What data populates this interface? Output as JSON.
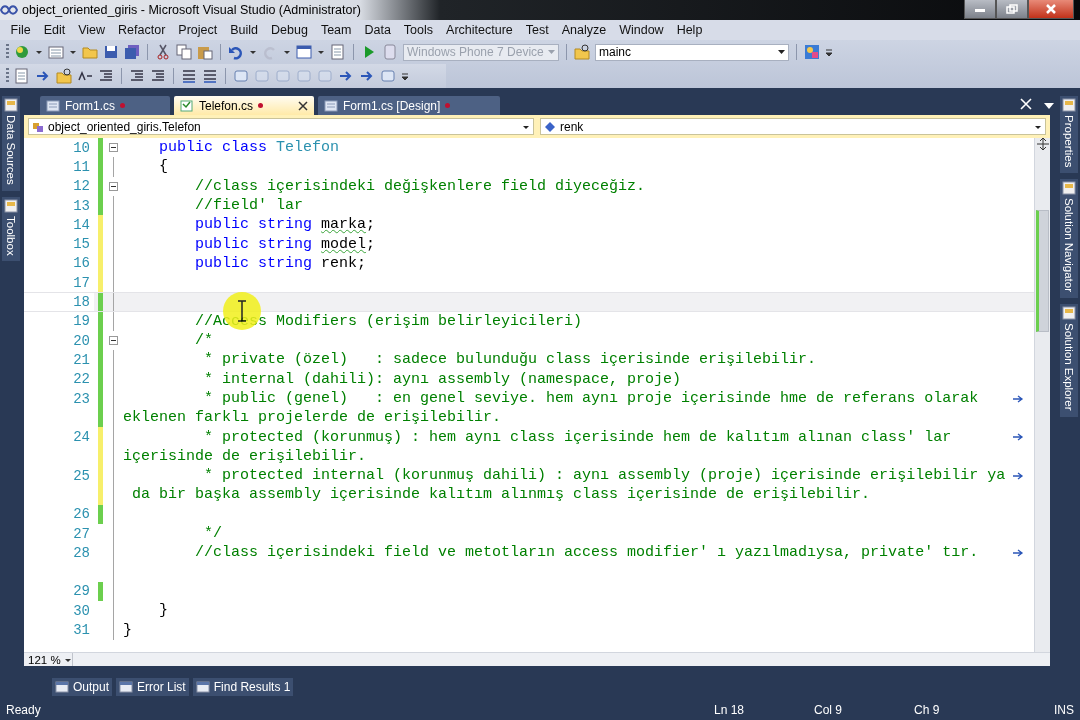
{
  "window": {
    "title": "object_oriented_giris - Microsoft Visual Studio (Administrator)"
  },
  "menu": [
    "File",
    "Edit",
    "View",
    "Refactor",
    "Project",
    "Build",
    "Debug",
    "Team",
    "Data",
    "Tools",
    "Architecture",
    "Test",
    "Analyze",
    "Window",
    "Help"
  ],
  "toolbar": {
    "platform": {
      "value": "Windows Phone 7 Device",
      "disabled": true
    },
    "find": {
      "value": "mainc"
    }
  },
  "left_dock": [
    "Data Sources",
    "Toolbox"
  ],
  "right_dock": [
    "Properties",
    "Solution Navigator",
    "Solution Explorer"
  ],
  "document_tabs": [
    {
      "label": "Form1.cs",
      "selected": false,
      "modified": true
    },
    {
      "label": "Telefon.cs",
      "selected": true,
      "modified": true
    },
    {
      "label": "Form1.cs [Design]",
      "selected": false,
      "modified": true
    }
  ],
  "navigation": {
    "type": "object_oriented_giris.Telefon",
    "member": "renk"
  },
  "editor": {
    "lines": [
      {
        "number": "10",
        "color": "#6ccf4e",
        "foldable": true,
        "current": false,
        "wrapped": false,
        "spans": [
          {
            "kind": "keyword",
            "text": "    public class "
          },
          {
            "kind": "type",
            "text": "Telefon"
          }
        ]
      },
      {
        "number": "11",
        "color": "#6ccf4e",
        "foldable": false,
        "current": false,
        "wrapped": false,
        "spans": [
          {
            "kind": "plain",
            "text": "    {"
          }
        ]
      },
      {
        "number": "12",
        "color": "#6ccf4e",
        "foldable": true,
        "current": false,
        "wrapped": false,
        "spans": [
          {
            "kind": "comment",
            "text": "        //class içerisindeki değişkenlere field diyeceğiz."
          }
        ]
      },
      {
        "number": "13",
        "color": "#6ccf4e",
        "foldable": false,
        "current": false,
        "wrapped": false,
        "spans": [
          {
            "kind": "comment",
            "text": "        //field' lar"
          }
        ]
      },
      {
        "number": "14",
        "color": "#f7ef6b",
        "foldable": false,
        "current": false,
        "wrapped": false,
        "spans": [
          {
            "kind": "keyword",
            "text": "        public string "
          },
          {
            "kind": "warning",
            "text": "marka"
          },
          {
            "kind": "plain",
            "text": ";"
          }
        ]
      },
      {
        "number": "15",
        "color": "#f7ef6b",
        "foldable": false,
        "current": false,
        "wrapped": false,
        "spans": [
          {
            "kind": "keyword",
            "text": "        public string "
          },
          {
            "kind": "warning",
            "text": "model"
          },
          {
            "kind": "plain",
            "text": ";"
          }
        ]
      },
      {
        "number": "16",
        "color": "#f7ef6b",
        "foldable": false,
        "current": false,
        "wrapped": false,
        "spans": [
          {
            "kind": "keyword",
            "text": "        public string "
          },
          {
            "kind": "plain",
            "text": "renk;"
          }
        ]
      },
      {
        "number": "17",
        "color": "#f7ef6b",
        "foldable": false,
        "current": false,
        "wrapped": false
      },
      {
        "number": "18",
        "color": "#6ccf4e",
        "foldable": false,
        "current": true,
        "wrapped": false
      },
      {
        "number": "19",
        "color": "#6ccf4e",
        "foldable": false,
        "current": false,
        "wrapped": false,
        "spans": [
          {
            "kind": "comment",
            "text": "        //Access Modifiers (erişim belirleyicileri)"
          }
        ]
      },
      {
        "number": "20",
        "color": "#6ccf4e",
        "foldable": true,
        "current": false,
        "wrapped": false,
        "spans": [
          {
            "kind": "comment",
            "text": "        /*"
          }
        ]
      },
      {
        "number": "21",
        "color": "#6ccf4e",
        "foldable": false,
        "current": false,
        "wrapped": false,
        "spans": [
          {
            "kind": "comment",
            "text": "         * private (özel)   : sadece bulunduğu class içerisinde erişilebilir."
          }
        ]
      },
      {
        "number": "22",
        "color": "#6ccf4e",
        "foldable": false,
        "current": false,
        "wrapped": false,
        "spans": [
          {
            "kind": "comment",
            "text": "         * internal (dahili): aynı assembly (namespace, proje)"
          }
        ]
      },
      {
        "number": "23",
        "color": "#6ccf4e",
        "foldable": false,
        "current": false,
        "wrapped": true,
        "spans": [
          {
            "kind": "comment",
            "text": "         * public (genel)   : en genel seviye. hem aynı proje içerisinde hme de referans olarak"
          }
        ],
        "continuation": "eklenen farklı projelerde de erişilebilir."
      },
      {
        "number": "24",
        "color": "#f7ef6b",
        "foldable": false,
        "current": false,
        "wrapped": true,
        "spans": [
          {
            "kind": "comment",
            "text": "         * protected (korunmuş) : hem aynı class içerisinde hem de kalıtım alınan class' lar"
          }
        ],
        "continuation": "içerisinde de erişilebilir."
      },
      {
        "number": "25",
        "color": "#f7ef6b",
        "foldable": false,
        "current": false,
        "wrapped": true,
        "spans": [
          {
            "kind": "comment",
            "text": "         * protected internal (korunmuş dahili) : aynı assembly (proje) içerisinde erişilebilir ya"
          }
        ],
        "continuation": " da bir başka assembly içerisinde kalıtım alınmış class içerisinde de erişilebilir."
      },
      {
        "number": "26",
        "color": "#6ccf4e",
        "foldable": false,
        "current": false,
        "wrapped": false
      },
      {
        "number": "27",
        "foldable": false,
        "current": false,
        "wrapped": false,
        "spans": [
          {
            "kind": "comment",
            "text": "         */"
          }
        ]
      },
      {
        "number": "28",
        "foldable": false,
        "current": false,
        "wrapped": true,
        "spans": [
          {
            "kind": "comment",
            "text": "        //class içerisindeki field ve metotların access modifier' ı yazılmadıysa, private' tır."
          }
        ]
      },
      {
        "number": "29",
        "color": "#6ccf4e",
        "foldable": false,
        "current": false,
        "wrapped": false
      },
      {
        "number": "30",
        "foldable": false,
        "current": false,
        "wrapped": false,
        "spans": [
          {
            "kind": "plain",
            "text": "    }"
          }
        ]
      },
      {
        "number": "31",
        "foldable": false,
        "current": false,
        "wrapped": false,
        "spans": [
          {
            "kind": "plain",
            "text": "}"
          }
        ]
      }
    ]
  },
  "zoom": "121 %",
  "tool_tabs": [
    "Output",
    "Error List",
    "Find Results 1"
  ],
  "status_bar": {
    "message": "Ready",
    "line": "Ln 18",
    "column": "Col 9",
    "char": "Ch 9",
    "mode": "INS"
  }
}
